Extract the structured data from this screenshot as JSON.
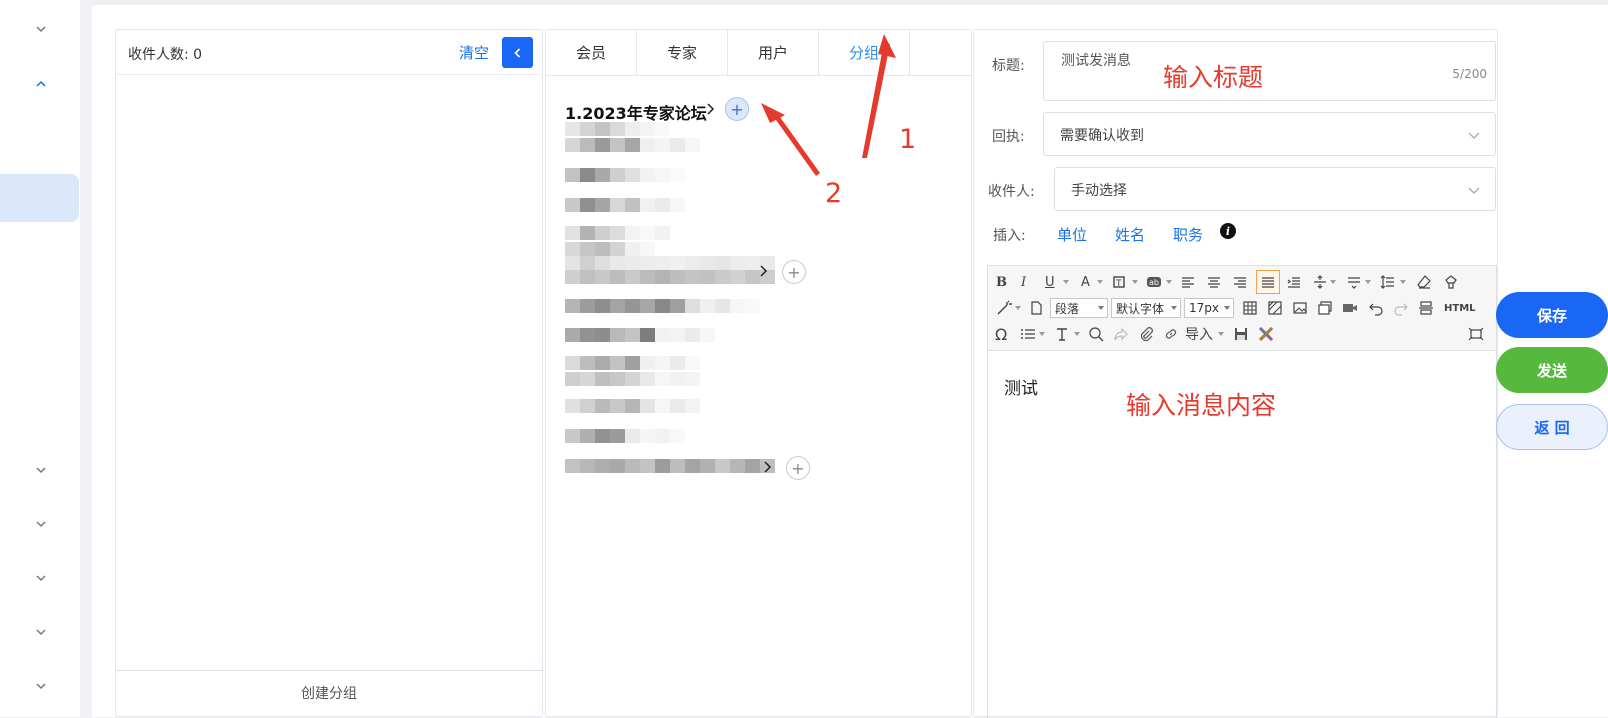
{
  "recipients": {
    "count_label": "收件人数: 0",
    "clear_label": "清空",
    "create_group_label": "创建分组"
  },
  "tabs": [
    {
      "label": "会员"
    },
    {
      "label": "专家"
    },
    {
      "label": "用户"
    },
    {
      "label": "分组",
      "active": true
    }
  ],
  "groups": {
    "first_title": "1.2023年专家论坛"
  },
  "form": {
    "title_label": "标题:",
    "title_value": "测试发消息",
    "title_counter": "5/200",
    "receipt_label": "回执:",
    "receipt_value": "需要确认收到",
    "recipient_label": "收件人:",
    "recipient_value": "手动选择",
    "insert_label": "插入:",
    "insert_options": [
      "单位",
      "姓名",
      "职务"
    ]
  },
  "editor": {
    "paragraph_select": "段落",
    "font_select": "默认字体",
    "size_select": "17px",
    "import_label": "导入",
    "html_label": "HTML",
    "content": "测试"
  },
  "actions": {
    "save": "保存",
    "send": "发送",
    "back": "返 回"
  },
  "annotations": {
    "title_hint": "输入标题",
    "content_hint": "输入消息内容",
    "step1": "1",
    "step2": "2"
  },
  "colors": {
    "primary": "#1a66f5",
    "send_green": "#56b93d",
    "annotation_red": "#e53b2f",
    "active_tab": "#2a8cf5"
  }
}
